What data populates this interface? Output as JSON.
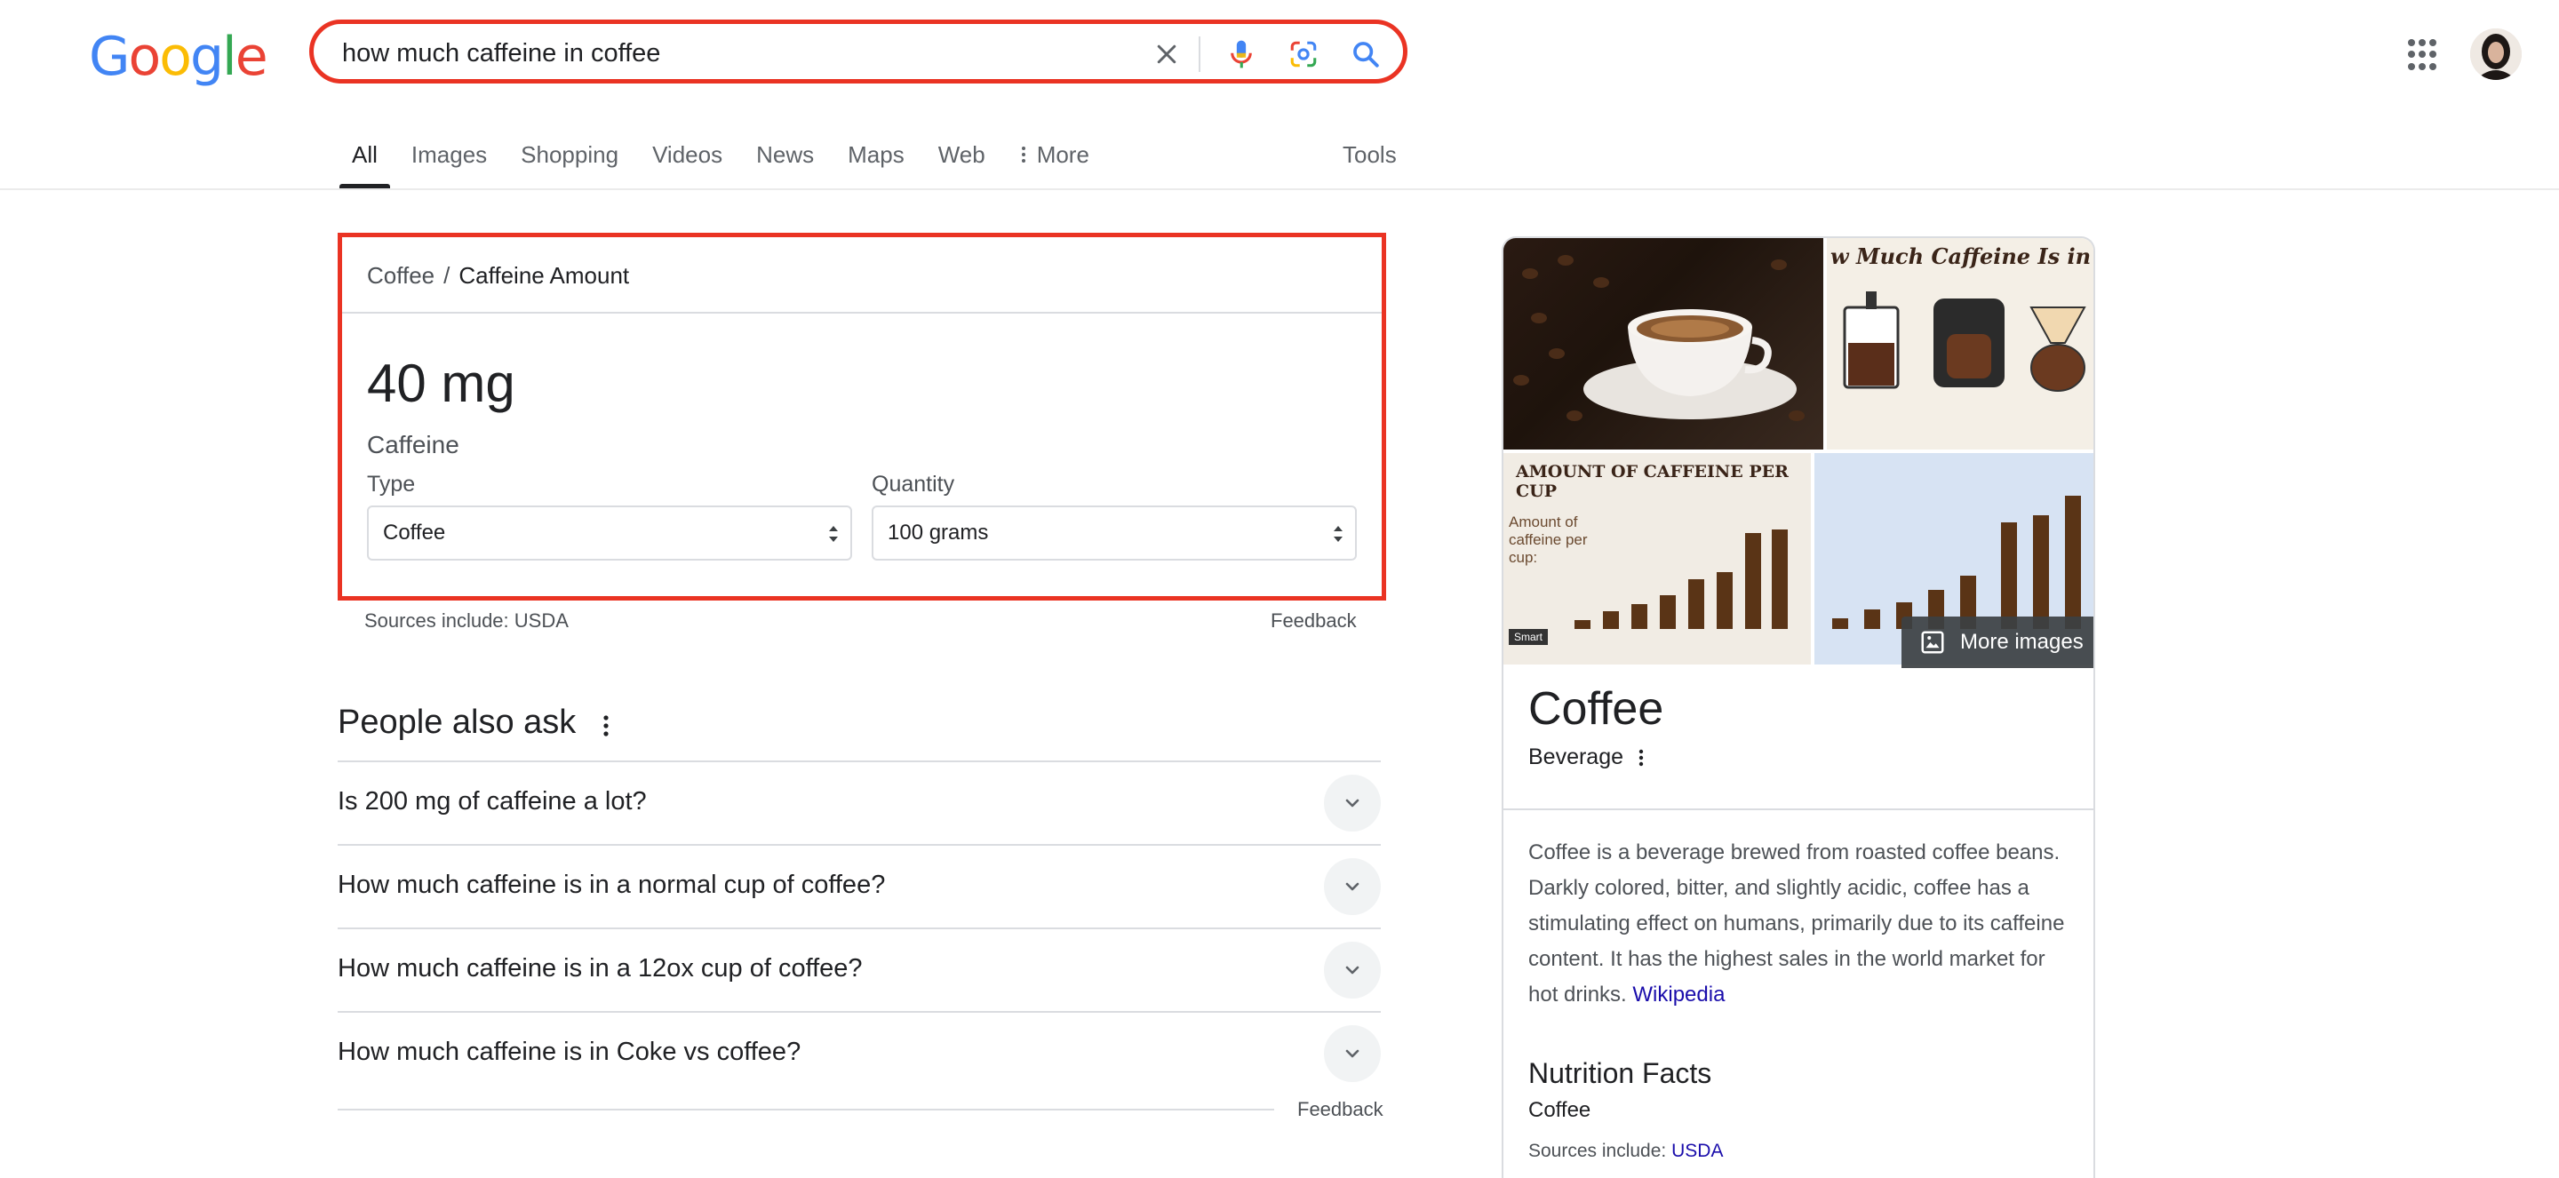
{
  "header": {
    "logo_letters": [
      {
        "ch": "G",
        "color": "#4285F4"
      },
      {
        "ch": "o",
        "color": "#EA4335"
      },
      {
        "ch": "o",
        "color": "#FBBC05"
      },
      {
        "ch": "g",
        "color": "#4285F4"
      },
      {
        "ch": "l",
        "color": "#34A853"
      },
      {
        "ch": "e",
        "color": "#EA4335"
      }
    ],
    "search_query": "how much caffeine in coffee"
  },
  "tabs": [
    {
      "label": "All",
      "active": true
    },
    {
      "label": "Images"
    },
    {
      "label": "Shopping"
    },
    {
      "label": "Videos"
    },
    {
      "label": "News"
    },
    {
      "label": "Maps"
    },
    {
      "label": "Web"
    },
    {
      "label": "More",
      "icon": "vertical-dots-icon"
    }
  ],
  "tools_label": "Tools",
  "answer": {
    "breadcrumb_parent": "Coffee",
    "breadcrumb_separator": "/",
    "breadcrumb_current": "Caffeine Amount",
    "value": "40 mg",
    "value_label": "Caffeine",
    "type_label": "Type",
    "type_value": "Coffee",
    "quantity_label": "Quantity",
    "quantity_value": "100 grams",
    "sources": "Sources include: USDA",
    "feedback": "Feedback"
  },
  "people_also_ask": {
    "title": "People also ask",
    "questions": [
      "Is 200 mg of caffeine a lot?",
      "How much caffeine is in a normal cup of coffee?",
      "How much caffeine is in a 12ox cup of coffee?",
      "How much caffeine is in Coke vs coffee?"
    ],
    "feedback": "Feedback"
  },
  "knowledge_panel": {
    "images": {
      "img2_caption": "w Much Caffeine Is in Coffe",
      "img3_caption": "AMOUNT OF CAFFEINE PER CUP",
      "img3_subcaption": "Amount of caffeine per cup:",
      "img3_tag": "Smart",
      "more_images": "More images"
    },
    "title": "Coffee",
    "subtitle": "Beverage",
    "description": "Coffee is a beverage brewed from roasted coffee beans. Darkly colored, bitter, and slightly acidic, coffee has a stimulating effect on humans, primarily due to its caffeine content. It has the highest sales in the world market for hot drinks.",
    "description_link": "Wikipedia",
    "nutrition_title": "Nutrition Facts",
    "nutrition_item": "Coffee",
    "nutrition_sources_prefix": "Sources include:",
    "nutrition_sources_link": "USDA"
  },
  "colors": {
    "highlight_red": "#ea3323",
    "link_blue": "#1a0dab",
    "coffee_brown": "#5a3416"
  }
}
